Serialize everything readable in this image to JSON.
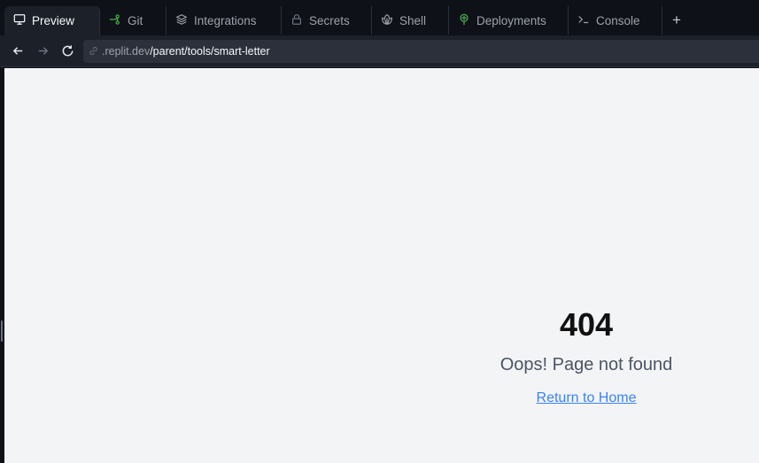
{
  "tabs": [
    {
      "label": "Preview",
      "icon": "monitor-icon",
      "active": true
    },
    {
      "label": "Git",
      "icon": "git-branch-icon",
      "active": false
    },
    {
      "label": "Integrations",
      "icon": "layers-icon",
      "active": false
    },
    {
      "label": "Secrets",
      "icon": "lock-icon",
      "active": false
    },
    {
      "label": "Shell",
      "icon": "shell-icon",
      "active": false
    },
    {
      "label": "Deployments",
      "icon": "deployments-icon",
      "active": false
    },
    {
      "label": "Console",
      "icon": "terminal-prompt-icon",
      "active": false
    }
  ],
  "add_tab_label": "+",
  "urlbar": {
    "domain": ".replit.dev",
    "path": "/parent/tools/smart-letter"
  },
  "page": {
    "code": "404",
    "message": "Oops! Page not found",
    "link": "Return to Home"
  },
  "colors": {
    "chrome_bg": "#0e1117",
    "panel_bg": "#1c2028",
    "page_bg": "#f3f4f6",
    "link": "#3b82f6",
    "git_icon": "#4caf50",
    "deploy_icon": "#4caf50"
  }
}
